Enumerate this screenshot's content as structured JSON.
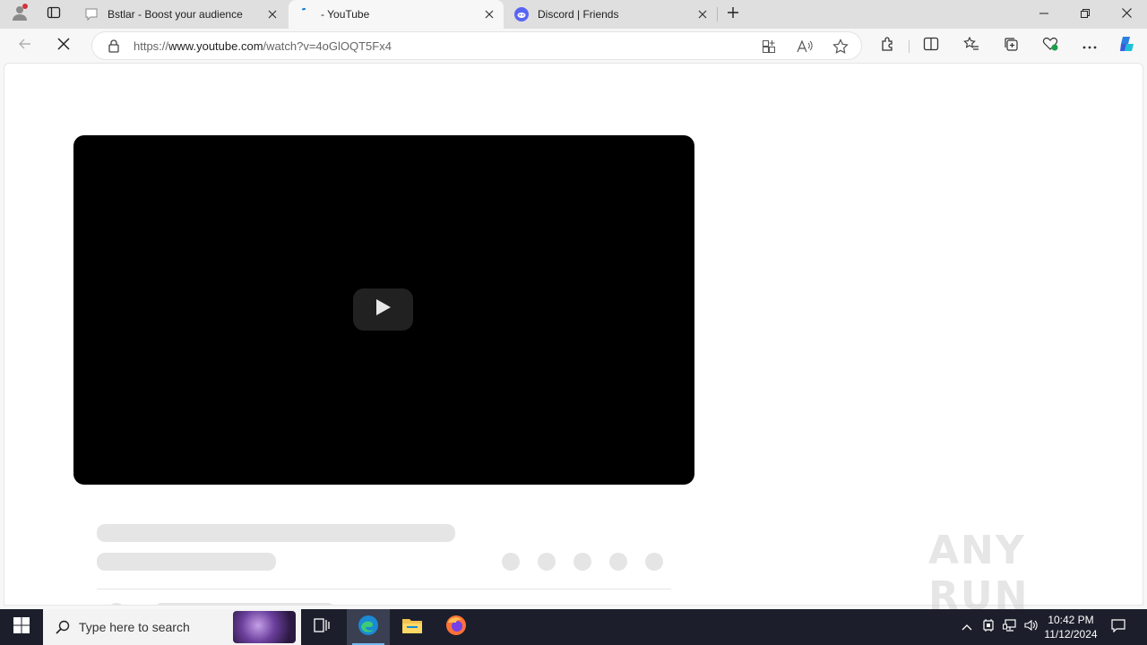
{
  "tabs": [
    {
      "title": "Bstlar - Boost your audience",
      "favicon": "chat-bubble-icon",
      "active": false
    },
    {
      "title": "- YouTube",
      "favicon": "loading-icon",
      "active": true
    },
    {
      "title": "Discord | Friends",
      "favicon": "discord-icon",
      "active": false
    }
  ],
  "address_bar": {
    "scheme": "https://",
    "host": "www.youtube.com",
    "path": "/watch?v=4oGlOQT5Fx4"
  },
  "taskbar": {
    "search_placeholder": "Type here to search",
    "time": "10:42 PM",
    "date": "11/12/2024"
  },
  "watermark": "ANY RUN",
  "colors": {
    "tabbar": "#dfdfdf",
    "toolbar": "#f7f7f7",
    "player": "#000000",
    "skeleton": "#e5e5e5",
    "taskbar": "#1c1f2b",
    "accent": "#0078d4"
  }
}
